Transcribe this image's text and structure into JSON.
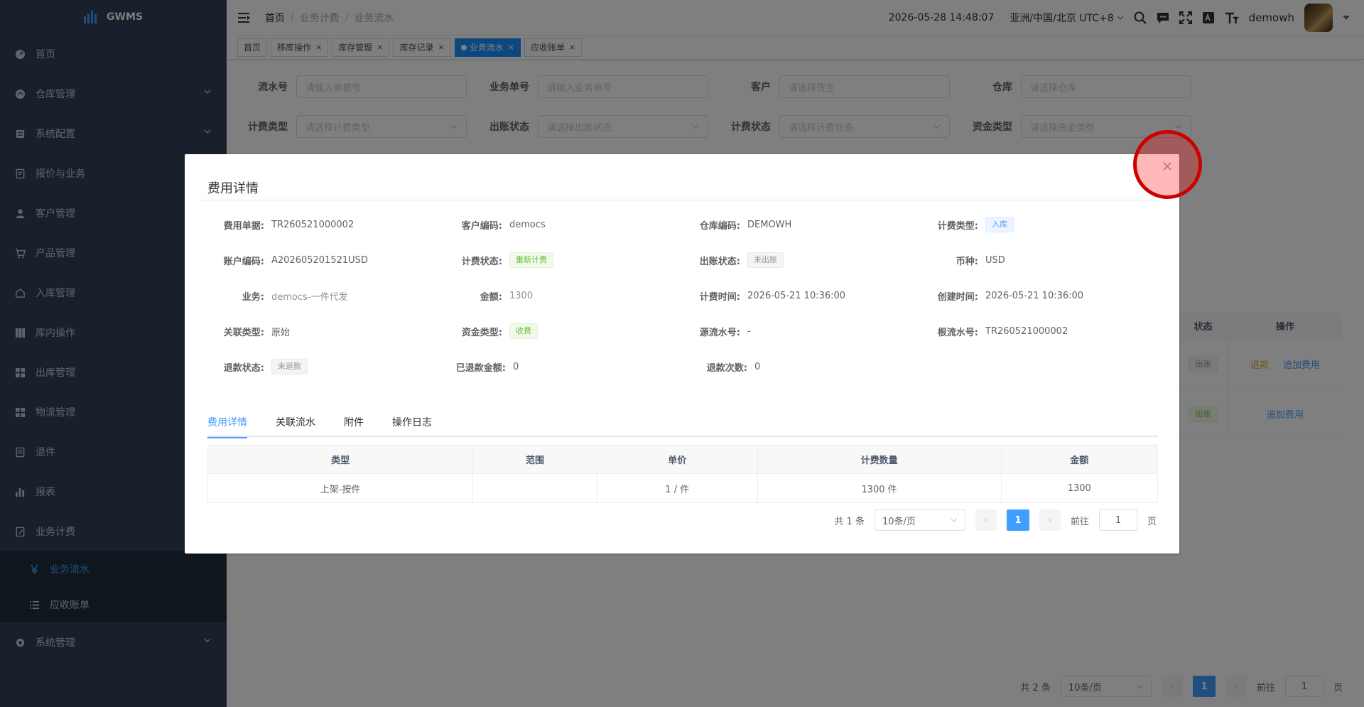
{
  "app": {
    "name": "GWMS"
  },
  "sidebar": {
    "items": [
      {
        "label": "首页",
        "icon": "dashboard-icon"
      },
      {
        "label": "仓库管理",
        "icon": "warehouse-icon",
        "arrow": true
      },
      {
        "label": "系统配置",
        "icon": "config-icon",
        "arrow": true
      },
      {
        "label": "报价与业务",
        "icon": "quote-icon"
      },
      {
        "label": "客户管理",
        "icon": "user-icon"
      },
      {
        "label": "产品管理",
        "icon": "cart-icon"
      },
      {
        "label": "入库管理",
        "icon": "inbound-icon"
      },
      {
        "label": "库内操作",
        "icon": "grid-icon"
      },
      {
        "label": "出库管理",
        "icon": "outbound-icon"
      },
      {
        "label": "物流管理",
        "icon": "logistics-icon"
      },
      {
        "label": "退件",
        "icon": "return-icon"
      },
      {
        "label": "报表",
        "icon": "chart-icon"
      },
      {
        "label": "业务计费",
        "icon": "billing-icon"
      }
    ],
    "submenu": [
      {
        "label": "业务流水",
        "icon": "yen-icon",
        "active": true
      },
      {
        "label": "应收账单",
        "icon": "list-icon",
        "active": false
      }
    ],
    "last": {
      "label": "系统管理",
      "icon": "gear-icon"
    }
  },
  "navbar": {
    "breadcrumb": [
      "首页",
      "业务计费",
      "业务流水"
    ],
    "datetime": "2026-05-28 14:48:07",
    "timezone": "亚洲/中国/北京 UTC+8",
    "username": "demowh"
  },
  "tags": [
    {
      "label": "首页",
      "active": false,
      "closable": false
    },
    {
      "label": "移库操作",
      "active": false,
      "closable": true
    },
    {
      "label": "库存管理",
      "active": false,
      "closable": true
    },
    {
      "label": "库存记录",
      "active": false,
      "closable": true
    },
    {
      "label": "业务流水",
      "active": true,
      "closable": true
    },
    {
      "label": "应收账单",
      "active": false,
      "closable": true
    }
  ],
  "search": {
    "row1": [
      {
        "label": "流水号",
        "placeholder": "请输入单据号"
      },
      {
        "label": "业务单号",
        "placeholder": "请输入业务单号"
      },
      {
        "label": "客户",
        "placeholder": "请选择货主"
      },
      {
        "label": "仓库",
        "placeholder": "请选择仓库"
      }
    ],
    "row2": [
      {
        "label": "计费类型",
        "placeholder": "请选择计费类型"
      },
      {
        "label": "出账状态",
        "placeholder": "请选择出账状态"
      },
      {
        "label": "计费状态",
        "placeholder": "请选择计费状态"
      },
      {
        "label": "资金类型",
        "placeholder": "请选择资金类型"
      }
    ]
  },
  "bg_table": {
    "header_status": "状态",
    "header_ops": "操作",
    "rows": [
      {
        "status": "出账",
        "ops": [
          "退款",
          "追加费用"
        ]
      },
      {
        "status": "出账",
        "ops": [
          "追加费用"
        ]
      }
    ],
    "pager": {
      "total": "共 2 条",
      "size": "10条/页",
      "page": "1",
      "goto": "前往",
      "page_unit": "页",
      "jump": "1"
    }
  },
  "dialog": {
    "title": "费用详情",
    "fields": [
      [
        {
          "label": "费用单据:",
          "value": "TR260521000002"
        },
        {
          "label": "客户编码:",
          "value": "democs"
        },
        {
          "label": "仓库编码:",
          "value": "DEMOWH"
        },
        {
          "label": "计费类型:",
          "badge": "入库",
          "badge_color": "blue"
        }
      ],
      [
        {
          "label": "账户编码:",
          "value": "A202605201521USD"
        },
        {
          "label": "计费状态:",
          "badge": "重新计费",
          "badge_color": "green"
        },
        {
          "label": "出账状态:",
          "badge": "未出账",
          "badge_color": "gray"
        },
        {
          "label": "币种:",
          "value": "USD"
        }
      ],
      [
        {
          "label": "业务:",
          "value": "democs-一件代发",
          "muted": true
        },
        {
          "label": "金额:",
          "value": "1300",
          "muted": true
        },
        {
          "label": "计费时间:",
          "value": "2026-05-21 10:36:00"
        },
        {
          "label": "创建时间:",
          "value": "2026-05-21 10:36:00"
        }
      ],
      [
        {
          "label": "关联类型:",
          "value": "原始"
        },
        {
          "label": "资金类型:",
          "badge": "收费",
          "badge_color": "green"
        },
        {
          "label": "源流水号:",
          "value": "-"
        },
        {
          "label": "根流水号:",
          "value": "TR260521000002",
          "link": true
        }
      ],
      [
        {
          "label": "退款状态:",
          "badge": "未退款",
          "badge_color": "gray"
        },
        {
          "label": "已退款金额:",
          "value": "0"
        },
        {
          "label": "退款次数:",
          "value": "0"
        }
      ]
    ],
    "tabs": [
      {
        "label": "费用详情",
        "active": true
      },
      {
        "label": "关联流水",
        "active": false
      },
      {
        "label": "附件",
        "active": false
      },
      {
        "label": "操作日志",
        "active": false
      }
    ],
    "table": {
      "headers": [
        "类型",
        "范围",
        "单价",
        "计费数量",
        "金额"
      ],
      "rows": [
        [
          "上架-按件",
          "",
          "1 / 件",
          "1300 件",
          "1300"
        ]
      ]
    },
    "pager": {
      "total": "共 1 条",
      "size": "10条/页",
      "page": "1",
      "goto": "前往",
      "jump": "1",
      "page_unit": "页"
    }
  },
  "colors": {
    "primary": "#409eff",
    "sidebar": "#304156",
    "highlight": "#cc0000"
  }
}
